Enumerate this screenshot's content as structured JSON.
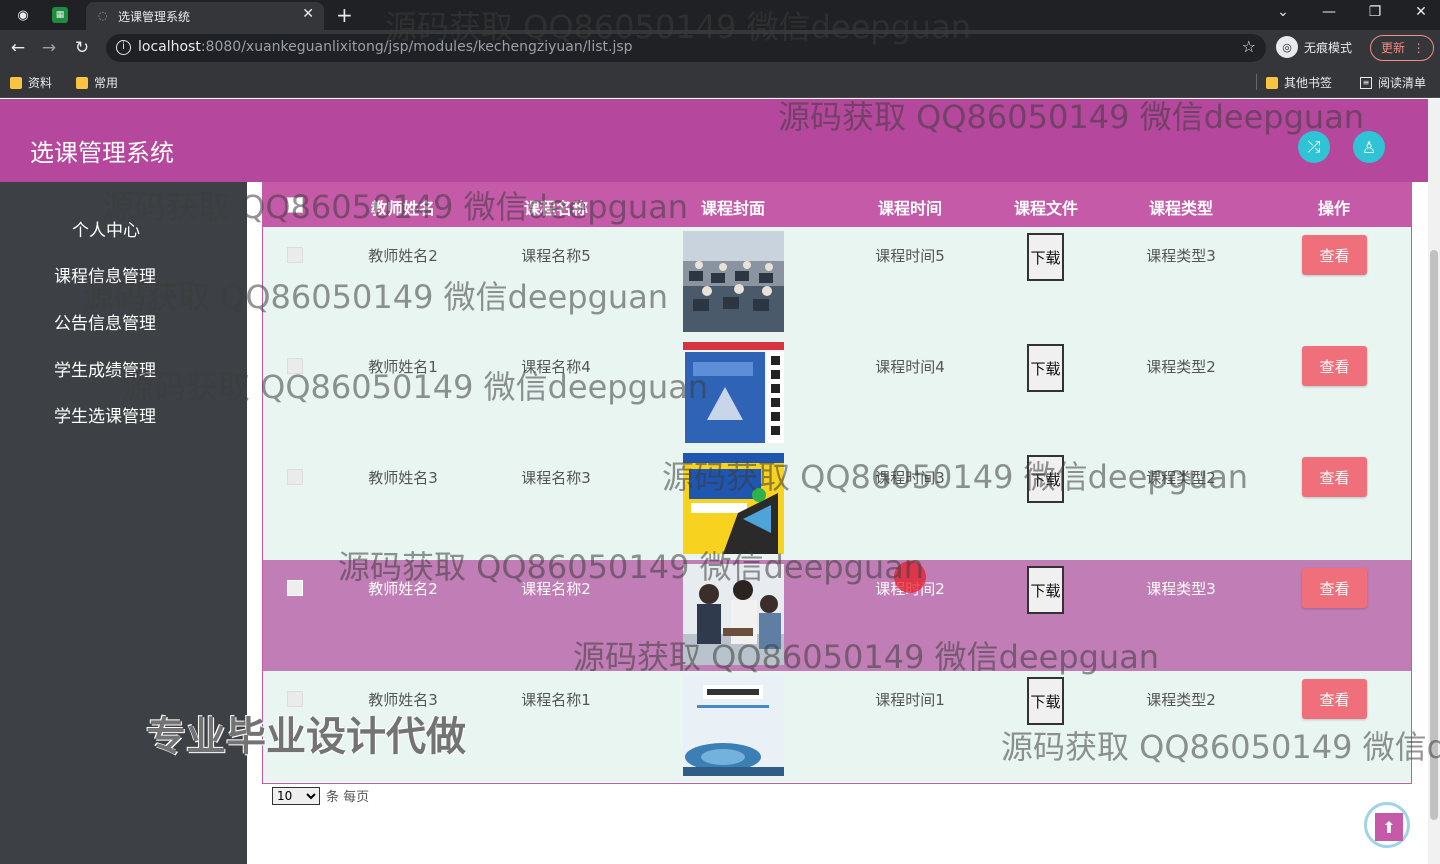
{
  "browser": {
    "tab_title": "选课管理系统",
    "url_host": "localhost",
    "url_rest": ":8080/xuankeguanlixitong/jsp/modules/kechengziyuan/list.jsp",
    "incognito_label": "无痕模式",
    "update_label": "更新",
    "bookmarks": [
      "资料",
      "常用"
    ],
    "bookmarks_right": [
      "其他书签",
      "阅读清单"
    ]
  },
  "app": {
    "title": "选课管理系统",
    "accent_color": "#b5479c",
    "header_icons": [
      "shuffle-icon",
      "user-icon"
    ]
  },
  "sidebar": {
    "items": [
      {
        "label": "个人中心"
      },
      {
        "label": "课程信息管理"
      },
      {
        "label": "公告信息管理"
      },
      {
        "label": "学生成绩管理"
      },
      {
        "label": "学生选课管理"
      }
    ]
  },
  "table": {
    "headers": [
      "教师姓名",
      "课程名称",
      "课程封面",
      "课程时间",
      "课程文件",
      "课程类型",
      "操作"
    ],
    "rows": [
      {
        "teacher": "教师姓名2",
        "course": "课程名称5",
        "cover": "classroom-photo",
        "time": "课程时间5",
        "file": "下载",
        "type": "课程类型3",
        "action": "查看"
      },
      {
        "teacher": "教师姓名1",
        "course": "课程名称4",
        "cover": "chemistry-book",
        "time": "课程时间4",
        "file": "下载",
        "type": "课程类型2",
        "action": "查看"
      },
      {
        "teacher": "教师姓名3",
        "course": "课程名称3",
        "cover": "math-book",
        "time": "课程时间3",
        "file": "下载",
        "type": "课程类型2",
        "action": "查看"
      },
      {
        "teacher": "教师姓名2",
        "course": "课程名称2",
        "cover": "students-photo",
        "time": "课程时间2",
        "file": "下载",
        "type": "课程类型3",
        "action": "查看",
        "selected": true
      },
      {
        "teacher": "教师姓名3",
        "course": "课程名称1",
        "cover": "physics-book",
        "time": "课程时间1",
        "file": "下载",
        "type": "课程类型2",
        "action": "查看"
      }
    ]
  },
  "pager": {
    "page_size": "10",
    "suffix": "条 每页"
  },
  "overlays": {
    "watermark": "源码获取 QQ86050149 微信deepguan",
    "watermark_cut": "源码获取 QQ86050149 微信dee",
    "watermark_big": "专业毕业设计代做"
  }
}
